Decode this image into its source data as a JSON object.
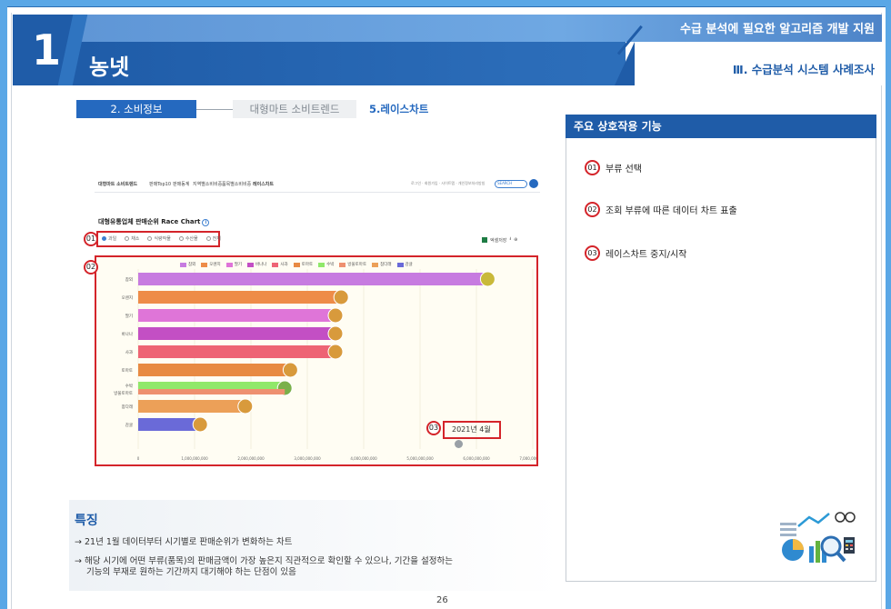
{
  "header": {
    "number": "1",
    "title": "농넷",
    "subtitle": "수급 분석에 필요한 알고리즘 개발 지원",
    "section": "Ⅲ. 수급분석 시스템 사례조사"
  },
  "tabs": {
    "active": "2. 소비정보",
    "inactive": "대형마트 소비트렌드",
    "current": "5.레이스차트"
  },
  "screenshot": {
    "nav": [
      "대형마트 소비트렌드",
      "판매Top10",
      "판매동계",
      "지역별소비비중",
      "품목별소비비중",
      "레이스차트"
    ],
    "breadcrumb": "로그인 · 회원가입 · 사이트맵 · 개인정보처리방침",
    "search_placeholder": "SEARCH",
    "chart_title": "대형유통업체 판매순위 Race Chart",
    "filters": [
      "과일",
      "채소",
      "식량작물",
      "수산물",
      "전체"
    ],
    "excel_label": "엑셀저장",
    "date_label": "2021년 4월",
    "marks": [
      "01",
      "02",
      "03"
    ]
  },
  "chart_data": {
    "type": "bar",
    "categories": [
      "참외",
      "오렌지",
      "딸기",
      "바나나",
      "사과",
      "토마토",
      "수박",
      "방울토마토",
      "참다래",
      "감귤"
    ],
    "values": [
      6200000000,
      3600000000,
      3500000000,
      3500000000,
      3500000000,
      2700000000,
      2600000000,
      2600000000,
      1900000000,
      1100000000
    ],
    "colors": [
      "#c77be0",
      "#ee8c48",
      "#df75d8",
      "#c34fc4",
      "#ee6474",
      "#e88a42",
      "#90e86a",
      "#ee9070",
      "#eca058",
      "#6a6ad8"
    ],
    "xlim": [
      0,
      7000000000
    ],
    "xticks": [
      "0",
      "1,000,000,000",
      "2,000,000,000",
      "3,000,000,000",
      "4,000,000,000",
      "5,000,000,000",
      "6,000,000,000",
      "7,000,000,000"
    ],
    "legend": [
      "참외",
      "오렌지",
      "딸기",
      "바나나",
      "사과",
      "토마토",
      "수박",
      "방울토마토",
      "참다래",
      "감귤"
    ],
    "legend_colors": [
      "#c77be0",
      "#ee8c48",
      "#df75d8",
      "#c34fc4",
      "#ee6474",
      "#e88a42",
      "#90e86a",
      "#ee9070",
      "#eca058",
      "#6a6ad8"
    ],
    "ylabels": [
      "참외",
      "오렌지",
      "딸기",
      "바나나",
      "사과",
      "토마토",
      "수박\n방울토마토",
      "참다래",
      "감귤"
    ]
  },
  "panel": {
    "title": "주요 상호작용 기능",
    "items": [
      {
        "num": "01",
        "text": "부류 선택"
      },
      {
        "num": "02",
        "text": "조회 부류에 따른 데이터 차트 표출"
      },
      {
        "num": "03",
        "text": "레이스차트 중지/시작"
      }
    ]
  },
  "features": {
    "title": "특징",
    "line1": "→ 21년 1월 데이터부터 시기별로 판매순위가 변화하는 차트",
    "line2": "→ 해당 시기에 어떤 부류(품목)의 판매금액이 가장 높은지 직관적으로 확인할 수 있으나, 기간을 설정하는",
    "line3": "기능의 부재로 원하는 기간까지 대기해야 하는 단점이 있음"
  },
  "page_number": "26"
}
